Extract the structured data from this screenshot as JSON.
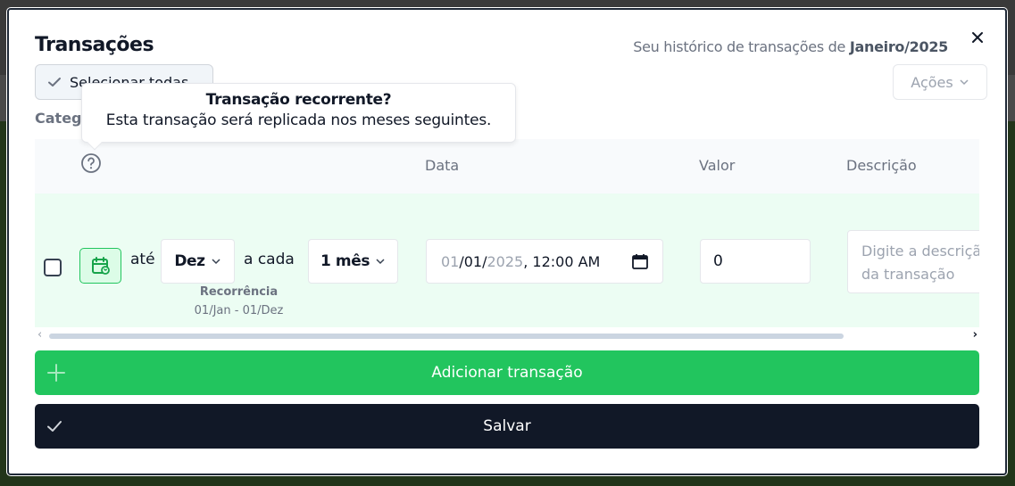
{
  "modal": {
    "title": "Transações",
    "subtitle_prefix": "Seu histórico de transações de",
    "subtitle_period": "Janeiro/2025",
    "close_icon": "close-icon"
  },
  "toolbar": {
    "select_all_label": "Selecionar todas",
    "actions_label": "Ações",
    "category_label": "Categ"
  },
  "tooltip": {
    "title": "Transação recorrente?",
    "body": "Esta transação será replicada nos meses seguintes."
  },
  "table": {
    "headers": [
      "Data",
      "Valor",
      "Descrição"
    ],
    "row": {
      "until_label": "até",
      "until_value": "Dez",
      "every_label": "a cada",
      "every_value": "1 mês",
      "recurrence_label": "Recorrência",
      "recurrence_range": "01/Jan - 01/Dez",
      "date_month": "01",
      "date_day": "01",
      "date_year": "2025",
      "date_time": ", 12:00 AM",
      "value": "0",
      "description_placeholder": "Digite a descrição da transação"
    }
  },
  "buttons": {
    "add_transaction": "Adicionar transação",
    "save": "Salvar"
  },
  "colors": {
    "accent_green": "#22c55e",
    "dark_button": "#111827",
    "row_bg": "#ecfdf3"
  }
}
